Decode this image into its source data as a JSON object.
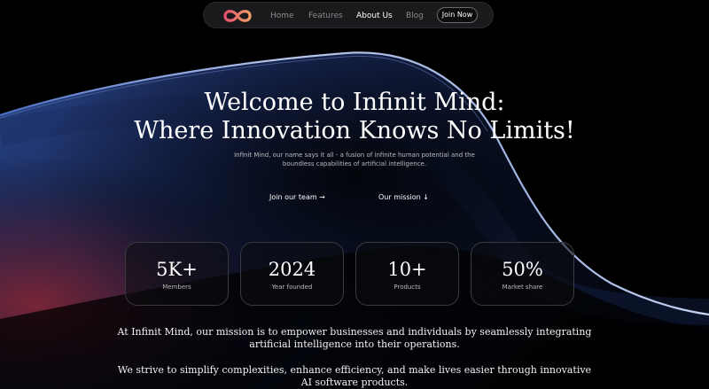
{
  "nav": {
    "logo_icon": "infinity-logo-icon",
    "links": [
      {
        "label": "Home",
        "active": false
      },
      {
        "label": "Features",
        "active": false
      },
      {
        "label": "About Us",
        "active": true
      },
      {
        "label": "Blog",
        "active": false
      }
    ],
    "cta_label": "Join Now"
  },
  "hero": {
    "title_line1": "Welcome to Infinit Mind:",
    "title_line2": "Where Innovation Knows No Limits!",
    "subtitle": "Infinit Mind, our name says it all - a fusion of infinite human potential and the boundless capabilities of artificial intelligence.",
    "link_team": "Join our team →",
    "link_mission": "Our mission ↓"
  },
  "stats": [
    {
      "value": "5K+",
      "label": "Members"
    },
    {
      "value": "2024",
      "label": "Year founded"
    },
    {
      "value": "10+",
      "label": "Products"
    },
    {
      "value": "50%",
      "label": "Market share"
    }
  ],
  "mission": {
    "paragraph1": "At Infinit Mind, our mission is to empower businesses and individuals by seamlessly integrating artificial intelligence into their operations.",
    "paragraph2": "We strive to simplify complexities, enhance efficiency, and make lives easier through innovative AI software products."
  },
  "colors": {
    "background": "#000000",
    "logo_gradient_start": "#e8506e",
    "logo_gradient_end": "#f0a066",
    "wave_blue": "#3a5fb0",
    "wave_red": "#8a2530"
  }
}
